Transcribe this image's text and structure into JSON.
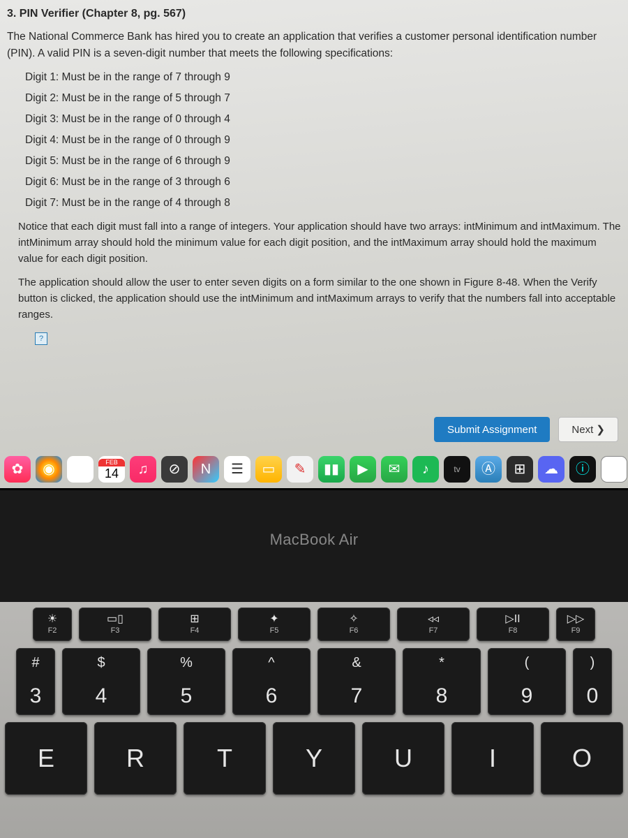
{
  "assignment": {
    "heading": "3. PIN Verifier (Chapter 8, pg. 567)",
    "intro": "The National Commerce Bank has hired you to create an application that verifies a customer personal identification number (PIN). A valid PIN is a seven-digit number that meets the following specifications:",
    "specs": [
      "Digit 1: Must be in the range of 7 through 9",
      "Digit 2: Must be in the range of 5 through 7",
      "Digit 3: Must be in the range of 0 through 4",
      "Digit 4: Must be in the range of 0 through 9",
      "Digit 5: Must be in the range of 6 through 9",
      "Digit 6: Must be in the range of 3 through 6",
      "Digit 7: Must be in the range of 4 through 8"
    ],
    "para1": "Notice that each digit must fall into a range of integers. Your application should have two arrays: intMinimum and intMaximum. The intMinimum array should hold the minimum value for each digit position, and the intMaximum array should hold the maximum value for each digit position.",
    "para2": "The application should allow the user to enter seven digits on a form similar to the one shown in Figure 8-48. When the Verify button is clicked, the application should use the intMinimum and intMaximum arrays to verify that the numbers fall into acceptable ranges.",
    "help_box": "?",
    "submit": "Submit Assignment",
    "next": "Next ❯"
  },
  "dock": {
    "calendar_month": "FEB",
    "calendar_day": "14",
    "tv_label": "tv"
  },
  "hardware": {
    "brand": "MacBook Air",
    "fkeys": [
      {
        "icon": "☀",
        "label": "F2"
      },
      {
        "icon": "▭▯",
        "label": "F3"
      },
      {
        "icon": "⊞",
        "label": "F4"
      },
      {
        "icon": "✦",
        "label": "F5"
      },
      {
        "icon": "✧",
        "label": "F6"
      },
      {
        "icon": "◃◃",
        "label": "F7"
      },
      {
        "icon": "▷II",
        "label": "F8"
      },
      {
        "icon": "▷▷",
        "label": "F9"
      }
    ],
    "numrow": [
      {
        "sym": "#",
        "num": "3"
      },
      {
        "sym": "$",
        "num": "4"
      },
      {
        "sym": "%",
        "num": "5"
      },
      {
        "sym": "^",
        "num": "6"
      },
      {
        "sym": "&",
        "num": "7"
      },
      {
        "sym": "*",
        "num": "8"
      },
      {
        "sym": "(",
        "num": "9"
      },
      {
        "sym": ")",
        "num": "0"
      }
    ],
    "letters": [
      "E",
      "R",
      "T",
      "Y",
      "U",
      "I",
      "O"
    ]
  }
}
